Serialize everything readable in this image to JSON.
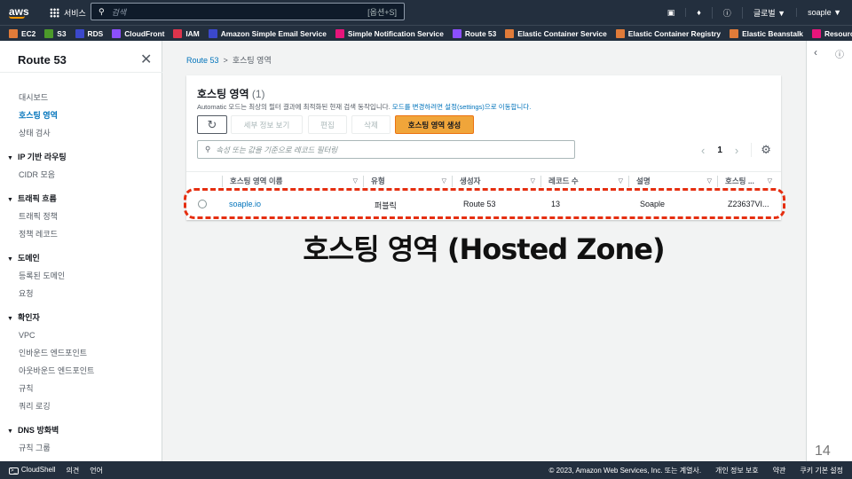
{
  "topnav": {
    "logo": "aws",
    "services": "서비스",
    "search_placeholder": "검색",
    "search_shortcut": "[옵션+S]",
    "region": "글로벌 ▼",
    "user": "soaple ▼"
  },
  "favorites": [
    {
      "label": "EC2",
      "color": "#e07b39"
    },
    {
      "label": "S3",
      "color": "#4c9a2a"
    },
    {
      "label": "RDS",
      "color": "#3b48cc"
    },
    {
      "label": "CloudFront",
      "color": "#8c4fff"
    },
    {
      "label": "IAM",
      "color": "#dd344c"
    },
    {
      "label": "Amazon Simple Email Service",
      "color": "#3b48cc"
    },
    {
      "label": "Simple Notification Service",
      "color": "#e7157b"
    },
    {
      "label": "Route 53",
      "color": "#8c4fff"
    },
    {
      "label": "Elastic Container Service",
      "color": "#e07b39"
    },
    {
      "label": "Elastic Container Registry",
      "color": "#e07b39"
    },
    {
      "label": "Elastic Beanstalk",
      "color": "#e07b39"
    },
    {
      "label": "Resource Groups & Tag Editor",
      "color": "#e7157b"
    }
  ],
  "sidebar": {
    "title": "Route 53",
    "items": [
      {
        "label": "대시보드",
        "type": "item"
      },
      {
        "label": "호스팅 영역",
        "type": "active"
      },
      {
        "label": "상태 검사",
        "type": "item"
      },
      {
        "label": "IP 기반 라우팅",
        "type": "sec"
      },
      {
        "label": "CIDR 모음",
        "type": "item"
      },
      {
        "label": "트래픽 흐름",
        "type": "sec"
      },
      {
        "label": "트래픽 정책",
        "type": "item"
      },
      {
        "label": "정책 레코드",
        "type": "item"
      },
      {
        "label": "도메인",
        "type": "sec"
      },
      {
        "label": "등록된 도메인",
        "type": "item"
      },
      {
        "label": "요청",
        "type": "item"
      },
      {
        "label": "확인자",
        "type": "sec"
      },
      {
        "label": "VPC",
        "type": "item"
      },
      {
        "label": "인바운드 엔드포인트",
        "type": "item"
      },
      {
        "label": "아웃바운드 엔드포인트",
        "type": "item"
      },
      {
        "label": "규칙",
        "type": "item"
      },
      {
        "label": "쿼리 로깅",
        "type": "item"
      },
      {
        "label": "DNS 방화벽",
        "type": "sec"
      },
      {
        "label": "규칙 그룹",
        "type": "item"
      }
    ]
  },
  "breadcrumb": {
    "root": "Route 53",
    "sep": ">",
    "current": "호스팅 영역"
  },
  "panel": {
    "title": "호스팅 영역",
    "count": "(1)",
    "desc": "Automatic 모드는 최상의 필터 결과에 최적화된 현재 검색 동작입니다.",
    "desc_link": "모드를 변경하려면 설정(settings)으로 이동합니다.",
    "buttons": {
      "details": "세부 정보 보기",
      "edit": "편집",
      "delete": "삭제",
      "create": "호스팅 영역 생성"
    },
    "filter_placeholder": "속성 또는 값을 기준으로 레코드 필터링",
    "page": "1",
    "columns": [
      "호스팅 영역 이름",
      "유형",
      "생성자",
      "레코드 수",
      "설명",
      "호스팅 ..."
    ],
    "rows": [
      [
        "soaple.io",
        "퍼블릭",
        "Route 53",
        "13",
        "Soaple",
        "Z23637VI..."
      ]
    ]
  },
  "annotation": "호스팅 영역 (Hosted Zone)",
  "page_number": "14",
  "footer": {
    "cloudshell": "CloudShell",
    "feedback": "의견",
    "language": "언어",
    "copyright": "© 2023, Amazon Web Services, Inc. 또는 계열사.",
    "privacy": "개인 정보 보호",
    "terms": "약관",
    "cookies": "쿠키 기본 설정"
  }
}
